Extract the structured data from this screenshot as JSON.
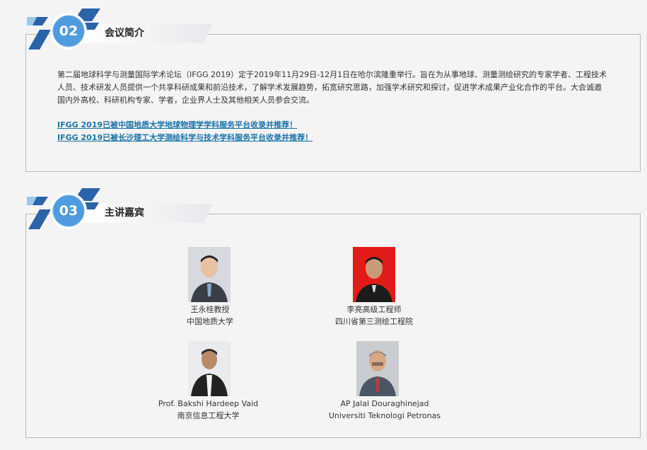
{
  "sections": [
    {
      "number": "02",
      "title": "会议简介",
      "intro": "第二届地球科学与测量国际学术论坛（IFGG 2019）定于2019年11月29日-12月1日在哈尔滨隆重举行。旨在为从事地球、测量测绘研究的专家学者、工程技术人员、技术研发人员提供一个共享科研成果和前沿技术，了解学术发展趋势，拓宽研究思路，加强学术研究和探讨，促进学术成果产业化合作的平台。大会诚邀国内外高校、科研机构专家、学者，企业界人士及其他相关人员参会交流。",
      "links": [
        "IFGG 2019已被中国地质大学地球物理学学科服务平台收录并推荐！",
        "IFGG 2019已被长沙理工大学测绘科学与技术学科服务平台收录并推荐！"
      ]
    },
    {
      "number": "03",
      "title": "主讲嘉宾"
    }
  ],
  "speakers": [
    {
      "name": "王永桂教授",
      "affiliation": "中国地质大学",
      "photo_bg": "#d6d9de"
    },
    {
      "name": "李亮高级工程师",
      "affiliation": "四川省第三测绘工程院",
      "photo_bg": "#e21b17"
    },
    {
      "name": "Prof. Bakshi Hardeep Vaid",
      "affiliation": "南京信息工程大学",
      "photo_bg": "#e9ebee"
    },
    {
      "name": "AP Jalal Douraghinejad",
      "affiliation": "Universiti Teknologi Petronas",
      "photo_bg": "#c9cdd1"
    }
  ],
  "colors": {
    "badge_dark": "#2b63a8",
    "badge_light": "#4f9be0",
    "link": "#1a73a8"
  }
}
